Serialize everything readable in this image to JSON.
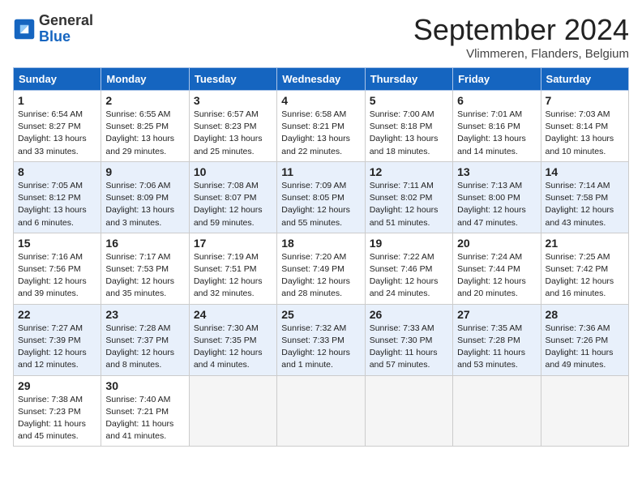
{
  "logo": {
    "general": "General",
    "blue": "Blue"
  },
  "header": {
    "month": "September 2024",
    "location": "Vlimmeren, Flanders, Belgium"
  },
  "weekdays": [
    "Sunday",
    "Monday",
    "Tuesday",
    "Wednesday",
    "Thursday",
    "Friday",
    "Saturday"
  ],
  "weeks": [
    [
      {
        "day": "1",
        "info": "Sunrise: 6:54 AM\nSunset: 8:27 PM\nDaylight: 13 hours\nand 33 minutes."
      },
      {
        "day": "2",
        "info": "Sunrise: 6:55 AM\nSunset: 8:25 PM\nDaylight: 13 hours\nand 29 minutes."
      },
      {
        "day": "3",
        "info": "Sunrise: 6:57 AM\nSunset: 8:23 PM\nDaylight: 13 hours\nand 25 minutes."
      },
      {
        "day": "4",
        "info": "Sunrise: 6:58 AM\nSunset: 8:21 PM\nDaylight: 13 hours\nand 22 minutes."
      },
      {
        "day": "5",
        "info": "Sunrise: 7:00 AM\nSunset: 8:18 PM\nDaylight: 13 hours\nand 18 minutes."
      },
      {
        "day": "6",
        "info": "Sunrise: 7:01 AM\nSunset: 8:16 PM\nDaylight: 13 hours\nand 14 minutes."
      },
      {
        "day": "7",
        "info": "Sunrise: 7:03 AM\nSunset: 8:14 PM\nDaylight: 13 hours\nand 10 minutes."
      }
    ],
    [
      {
        "day": "8",
        "info": "Sunrise: 7:05 AM\nSunset: 8:12 PM\nDaylight: 13 hours\nand 6 minutes."
      },
      {
        "day": "9",
        "info": "Sunrise: 7:06 AM\nSunset: 8:09 PM\nDaylight: 13 hours\nand 3 minutes."
      },
      {
        "day": "10",
        "info": "Sunrise: 7:08 AM\nSunset: 8:07 PM\nDaylight: 12 hours\nand 59 minutes."
      },
      {
        "day": "11",
        "info": "Sunrise: 7:09 AM\nSunset: 8:05 PM\nDaylight: 12 hours\nand 55 minutes."
      },
      {
        "day": "12",
        "info": "Sunrise: 7:11 AM\nSunset: 8:02 PM\nDaylight: 12 hours\nand 51 minutes."
      },
      {
        "day": "13",
        "info": "Sunrise: 7:13 AM\nSunset: 8:00 PM\nDaylight: 12 hours\nand 47 minutes."
      },
      {
        "day": "14",
        "info": "Sunrise: 7:14 AM\nSunset: 7:58 PM\nDaylight: 12 hours\nand 43 minutes."
      }
    ],
    [
      {
        "day": "15",
        "info": "Sunrise: 7:16 AM\nSunset: 7:56 PM\nDaylight: 12 hours\nand 39 minutes."
      },
      {
        "day": "16",
        "info": "Sunrise: 7:17 AM\nSunset: 7:53 PM\nDaylight: 12 hours\nand 35 minutes."
      },
      {
        "day": "17",
        "info": "Sunrise: 7:19 AM\nSunset: 7:51 PM\nDaylight: 12 hours\nand 32 minutes."
      },
      {
        "day": "18",
        "info": "Sunrise: 7:20 AM\nSunset: 7:49 PM\nDaylight: 12 hours\nand 28 minutes."
      },
      {
        "day": "19",
        "info": "Sunrise: 7:22 AM\nSunset: 7:46 PM\nDaylight: 12 hours\nand 24 minutes."
      },
      {
        "day": "20",
        "info": "Sunrise: 7:24 AM\nSunset: 7:44 PM\nDaylight: 12 hours\nand 20 minutes."
      },
      {
        "day": "21",
        "info": "Sunrise: 7:25 AM\nSunset: 7:42 PM\nDaylight: 12 hours\nand 16 minutes."
      }
    ],
    [
      {
        "day": "22",
        "info": "Sunrise: 7:27 AM\nSunset: 7:39 PM\nDaylight: 12 hours\nand 12 minutes."
      },
      {
        "day": "23",
        "info": "Sunrise: 7:28 AM\nSunset: 7:37 PM\nDaylight: 12 hours\nand 8 minutes."
      },
      {
        "day": "24",
        "info": "Sunrise: 7:30 AM\nSunset: 7:35 PM\nDaylight: 12 hours\nand 4 minutes."
      },
      {
        "day": "25",
        "info": "Sunrise: 7:32 AM\nSunset: 7:33 PM\nDaylight: 12 hours\nand 1 minute."
      },
      {
        "day": "26",
        "info": "Sunrise: 7:33 AM\nSunset: 7:30 PM\nDaylight: 11 hours\nand 57 minutes."
      },
      {
        "day": "27",
        "info": "Sunrise: 7:35 AM\nSunset: 7:28 PM\nDaylight: 11 hours\nand 53 minutes."
      },
      {
        "day": "28",
        "info": "Sunrise: 7:36 AM\nSunset: 7:26 PM\nDaylight: 11 hours\nand 49 minutes."
      }
    ],
    [
      {
        "day": "29",
        "info": "Sunrise: 7:38 AM\nSunset: 7:23 PM\nDaylight: 11 hours\nand 45 minutes."
      },
      {
        "day": "30",
        "info": "Sunrise: 7:40 AM\nSunset: 7:21 PM\nDaylight: 11 hours\nand 41 minutes."
      },
      {
        "day": "",
        "info": ""
      },
      {
        "day": "",
        "info": ""
      },
      {
        "day": "",
        "info": ""
      },
      {
        "day": "",
        "info": ""
      },
      {
        "day": "",
        "info": ""
      }
    ]
  ]
}
